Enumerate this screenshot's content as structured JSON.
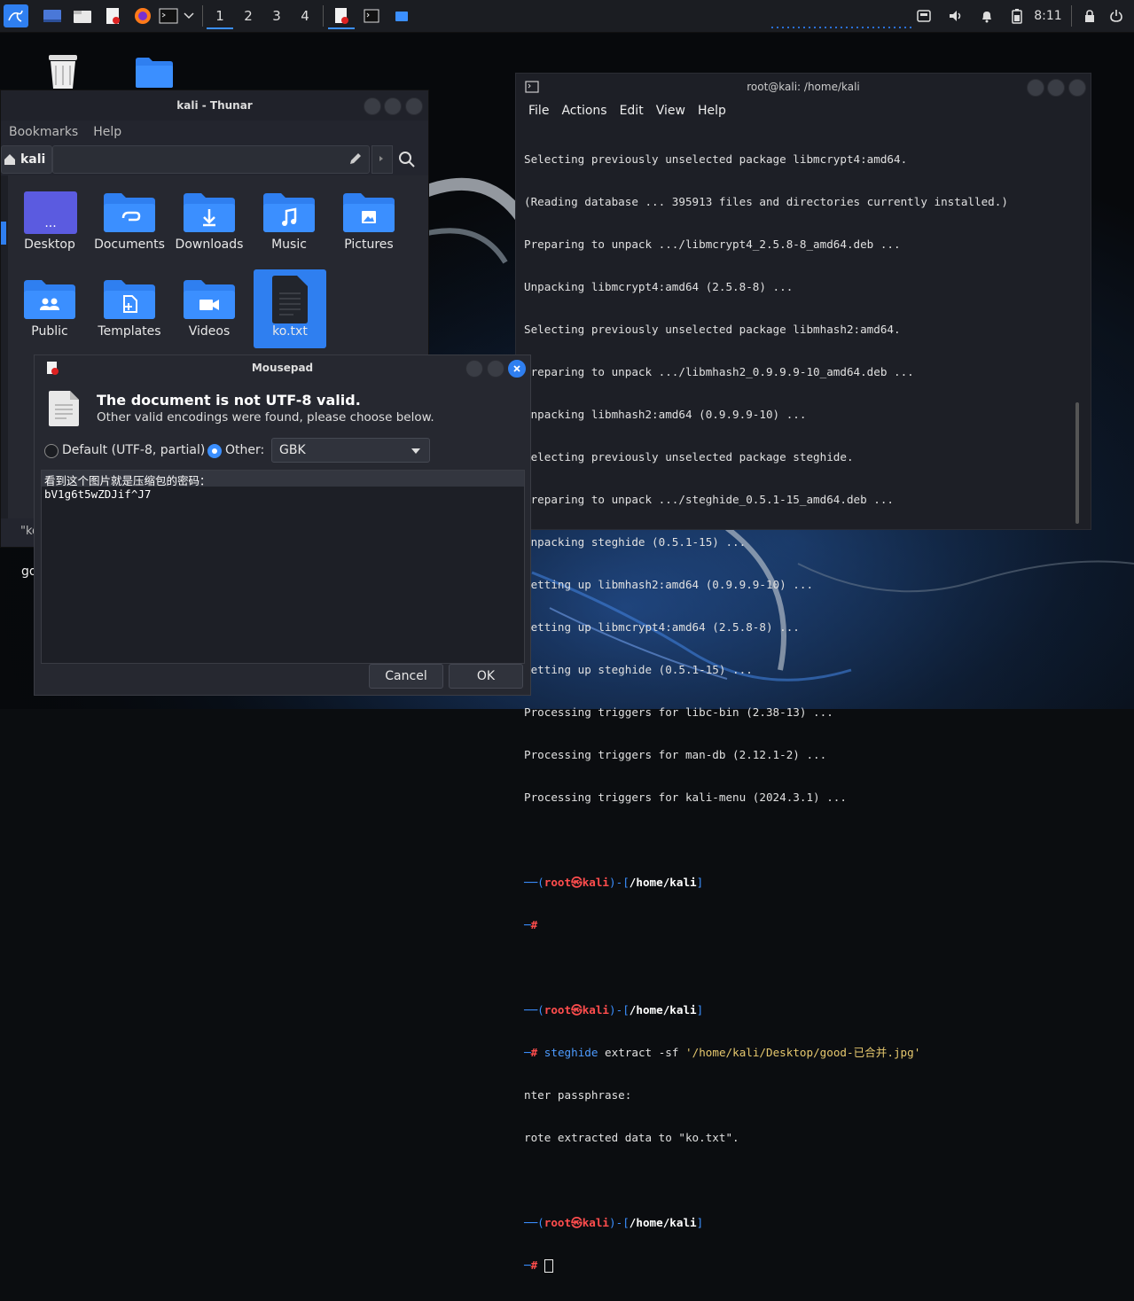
{
  "panel": {
    "workspaces": [
      "1",
      "2",
      "3",
      "4"
    ],
    "active_workspace": "1",
    "clock": "8:11"
  },
  "thunar": {
    "title": "kali - Thunar",
    "menu": [
      "Bookmarks",
      "Help"
    ],
    "location": "kali",
    "items": [
      {
        "label": "Desktop",
        "icon": "desktop-folder-icon"
      },
      {
        "label": "Documents",
        "icon": "documents-folder-icon"
      },
      {
        "label": "Downloads",
        "icon": "downloads-folder-icon"
      },
      {
        "label": "Music",
        "icon": "music-folder-icon"
      },
      {
        "label": "Pictures",
        "icon": "pictures-folder-icon"
      },
      {
        "label": "Public",
        "icon": "public-folder-icon"
      },
      {
        "label": "Templates",
        "icon": "templates-folder-icon"
      },
      {
        "label": "Videos",
        "icon": "videos-folder-icon"
      },
      {
        "label": "ko.txt",
        "icon": "text-file-icon",
        "selected": true
      }
    ],
    "status_partial": "\"ko",
    "desktop_partial": "go"
  },
  "terminal": {
    "title": "root@kali: /home/kali",
    "menu": [
      "File",
      "Actions",
      "Edit",
      "View",
      "Help"
    ],
    "output": [
      "Selecting previously unselected package libmcrypt4:amd64.",
      "(Reading database ... 395913 files and directories currently installed.)",
      "Preparing to unpack .../libmcrypt4_2.5.8-8_amd64.deb ...",
      "Unpacking libmcrypt4:amd64 (2.5.8-8) ...",
      "Selecting previously unselected package libmhash2:amd64.",
      "Preparing to unpack .../libmhash2_0.9.9.9-10_amd64.deb ...",
      "Unpacking libmhash2:amd64 (0.9.9.9-10) ...",
      "Selecting previously unselected package steghide.",
      "Preparing to unpack .../steghide_0.5.1-15_amd64.deb ...",
      "Unpacking steghide (0.5.1-15) ...",
      "Setting up libmhash2:amd64 (0.9.9.9-10) ...",
      "Setting up libmcrypt4:amd64 (2.5.8-8) ...",
      "Setting up steghide (0.5.1-15) ...",
      "Processing triggers for libc-bin (2.38-13) ...",
      "Processing triggers for man-db (2.12.1-2) ...",
      "Processing triggers for kali-menu (2024.3.1) ..."
    ],
    "prompt_user": "root",
    "prompt_host": "kali",
    "prompt_path": "/home/kali",
    "cmd_name": "steghide",
    "cmd_args": " extract -sf ",
    "cmd_file": "'/home/kali/Desktop/good-已合并.jpg'",
    "passphrase_line": "nter passphrase:",
    "wrote_line": "rote extracted data to \"ko.txt\"."
  },
  "mousepad": {
    "title": "Mousepad",
    "heading": "The document is not UTF-8 valid.",
    "subtext": "Other valid encodings were found, please choose below.",
    "option_default": "Default (UTF-8, partial)",
    "option_other": "Other:",
    "encoding": "GBK",
    "preview_lines": [
      "看到这个图片就是压缩包的密码：",
      "bV1g6t5wZDJif^J7"
    ],
    "cancel": "Cancel",
    "ok": "OK"
  },
  "colors": {
    "accent": "#3b8fff",
    "prompt_root": "#ff4d4d",
    "panel_bg": "#1b1d22"
  }
}
